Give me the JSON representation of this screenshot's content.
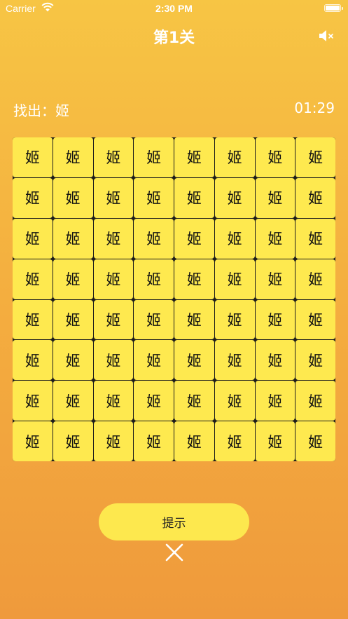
{
  "status_bar": {
    "carrier": "Carrier",
    "time": "2:30 PM",
    "wifi_icon": "wifi-icon",
    "battery_icon": "battery-icon"
  },
  "header": {
    "title": "第1关",
    "mute_icon": "speaker-muted-icon"
  },
  "game": {
    "target_label": "找出：姬",
    "timer": "01:29",
    "grid_rows": 8,
    "grid_cols": 8,
    "cells": [
      [
        "姬",
        "姬",
        "姬",
        "姬",
        "姬",
        "姬",
        "姬",
        "姬"
      ],
      [
        "姬",
        "姬",
        "姬",
        "姬",
        "姬",
        "姬",
        "姬",
        "姬"
      ],
      [
        "姬",
        "姬",
        "姬",
        "姬",
        "姬",
        "姬",
        "姬",
        "姬"
      ],
      [
        "姬",
        "姬",
        "姬",
        "姬",
        "姬",
        "姬",
        "姬",
        "姬"
      ],
      [
        "姬",
        "姬",
        "姬",
        "姬",
        "姬",
        "姬",
        "姬",
        "姬"
      ],
      [
        "姬",
        "姬",
        "姬",
        "姬",
        "姬",
        "姬",
        "姬",
        "姬"
      ],
      [
        "姬",
        "姬",
        "姬",
        "姬",
        "姬",
        "姬",
        "姬",
        "姬"
      ],
      [
        "姬",
        "姬",
        "姬",
        "姬",
        "姬",
        "姬",
        "姬",
        "姬"
      ]
    ]
  },
  "actions": {
    "hint_label": "提示",
    "close_icon": "close-icon"
  },
  "colors": {
    "background_top": "#f7c544",
    "background_bottom": "#ef9a3c",
    "cell": "#fee94f",
    "grid_line": "#1b1b1b",
    "hint_button": "#fde84e"
  }
}
